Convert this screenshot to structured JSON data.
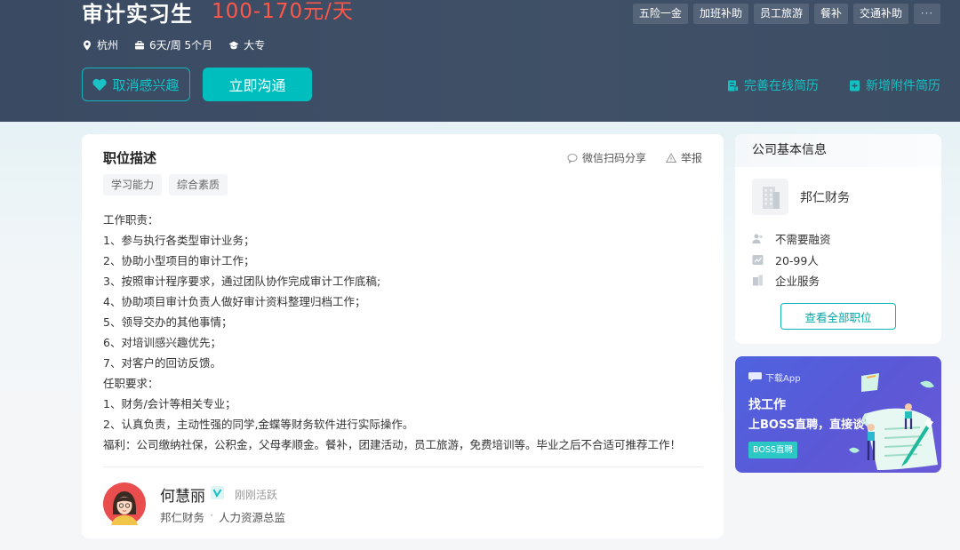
{
  "job": {
    "title": "审计实习生",
    "salary": "100-170元/天",
    "tags": [
      "五险一金",
      "加班补助",
      "员工旅游",
      "餐补",
      "交通补助"
    ],
    "more_tags": "···",
    "location": "杭州",
    "schedule": "6天/周 5个月",
    "education": "大专",
    "uninterest_label": "取消感兴趣",
    "chat_label": "立即沟通",
    "resume_online": "完善在线简历",
    "resume_attach": "新增附件简历"
  },
  "description": {
    "section_title": "职位描述",
    "share_label": "微信扫码分享",
    "report_label": "举报",
    "skills": [
      "学习能力",
      "综合素质"
    ],
    "lines": [
      "工作职责：",
      "1、参与执行各类型审计业务；",
      "2、协助小型项目的审计工作；",
      "3、按照审计程序要求，通过团队协作完成审计工作底稿;",
      "4、协助项目审计负责人做好审计资料整理归档工作；",
      "5、领导交办的其他事情；",
      "6、对培训感兴趣优先；",
      "7、对客户的回访反馈。",
      "任职要求：",
      "1、财务/会计等相关专业；",
      "2、认真负责，主动性强的同学,金蝶等财务软件进行实际操作。",
      "福利：公司缴纳社保，公积金，父母孝顺金。餐补，团建活动，员工旅游，免费培训等。毕业之后不合适可推荐工作！"
    ]
  },
  "recruiter": {
    "name": "何慧丽",
    "status": "刚刚活跃",
    "company": "邦仁财务",
    "separator": "·",
    "position": "人力资源总监"
  },
  "company": {
    "header": "公司基本信息",
    "name": "邦仁财务",
    "financing": "不需要融资",
    "size": "20-99人",
    "industry": "企业服务",
    "all_jobs_label": "查看全部职位"
  },
  "app": {
    "download": "下载App",
    "find_job": "找工作",
    "slogan": "上BOSS直聘，直接谈",
    "badge": "BOSS直聘"
  },
  "colors": {
    "header_bg": "#3d4d64",
    "accent": "#00bebd",
    "salary": "#fe574a"
  }
}
